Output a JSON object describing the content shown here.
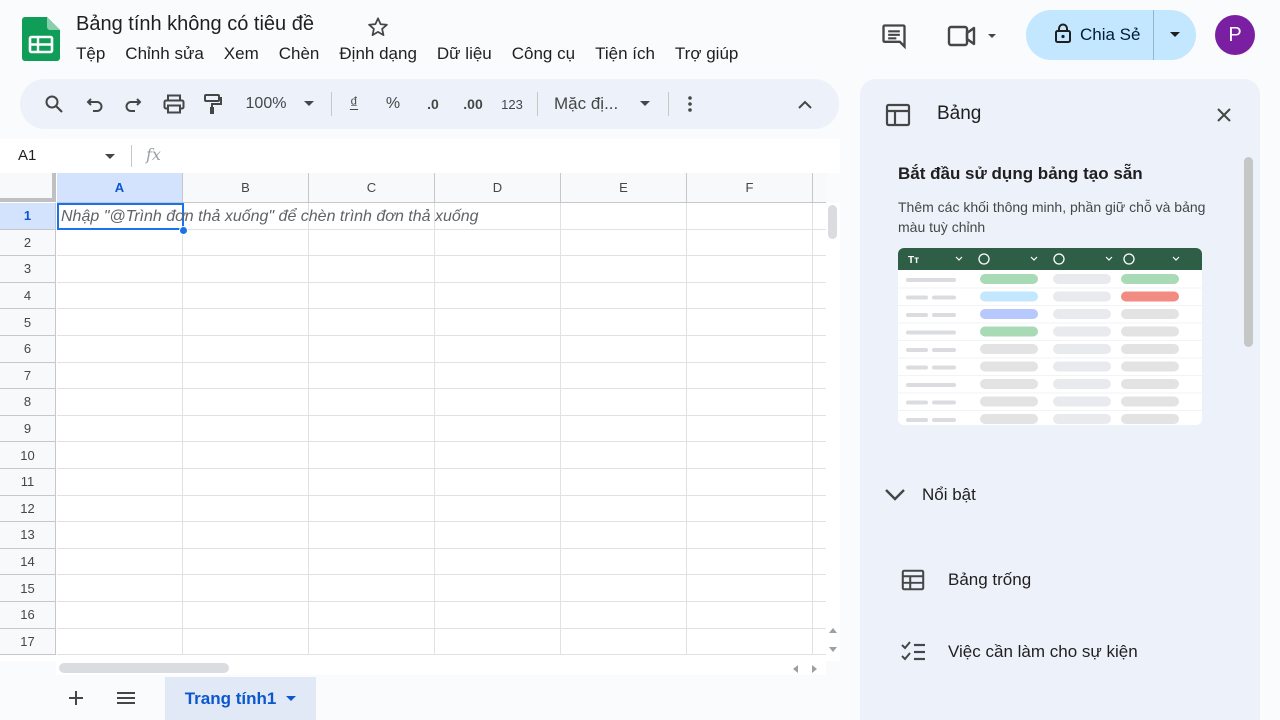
{
  "header": {
    "title": "Bảng tính không có tiêu đề",
    "menu": [
      "Tệp",
      "Chỉnh sửa",
      "Xem",
      "Chèn",
      "Định dạng",
      "Dữ liệu",
      "Công cụ",
      "Tiện ích",
      "Trợ giúp"
    ],
    "share_label": "Chia Sẻ",
    "avatar_initial": "P"
  },
  "toolbar": {
    "zoom": "100%",
    "currency": "₫",
    "percent": "%",
    "decrease_decimal": ".0",
    "increase_decimal": ".00",
    "number_format": "123",
    "font": "Mặc đị..."
  },
  "formula_bar": {
    "name_box": "A1",
    "fx": "fx"
  },
  "grid": {
    "columns": [
      "A",
      "B",
      "C",
      "D",
      "E",
      "F"
    ],
    "rows": [
      "1",
      "2",
      "3",
      "4",
      "5",
      "6",
      "7",
      "8",
      "9",
      "10",
      "11",
      "12",
      "13",
      "14",
      "15",
      "16",
      "17"
    ],
    "selected_cell": "A1",
    "cell_hint": "Nhập \"@Trình đơn thả xuống\" để chèn trình đơn thả xuống"
  },
  "sheets": {
    "active_tab": "Trang tính1"
  },
  "side_panel": {
    "title": "Bảng",
    "card_title": "Bắt đầu sử dụng bảng tạo sẵn",
    "card_desc": "Thêm các khối thông minh, phần giữ chỗ và bảng màu tuỳ chỉnh",
    "preview_header_label": "Tт",
    "featured_label": "Nổi bật",
    "templates": [
      "Bảng trống",
      "Việc cần làm cho sự kiện"
    ]
  },
  "colors": {
    "accent": "#0b57d0",
    "selection": "#1a73e8",
    "share_bg": "#c2e7ff",
    "avatar": "#7b1fa2",
    "logo": "#0f9d58",
    "preview_header": "#2f5e47"
  }
}
